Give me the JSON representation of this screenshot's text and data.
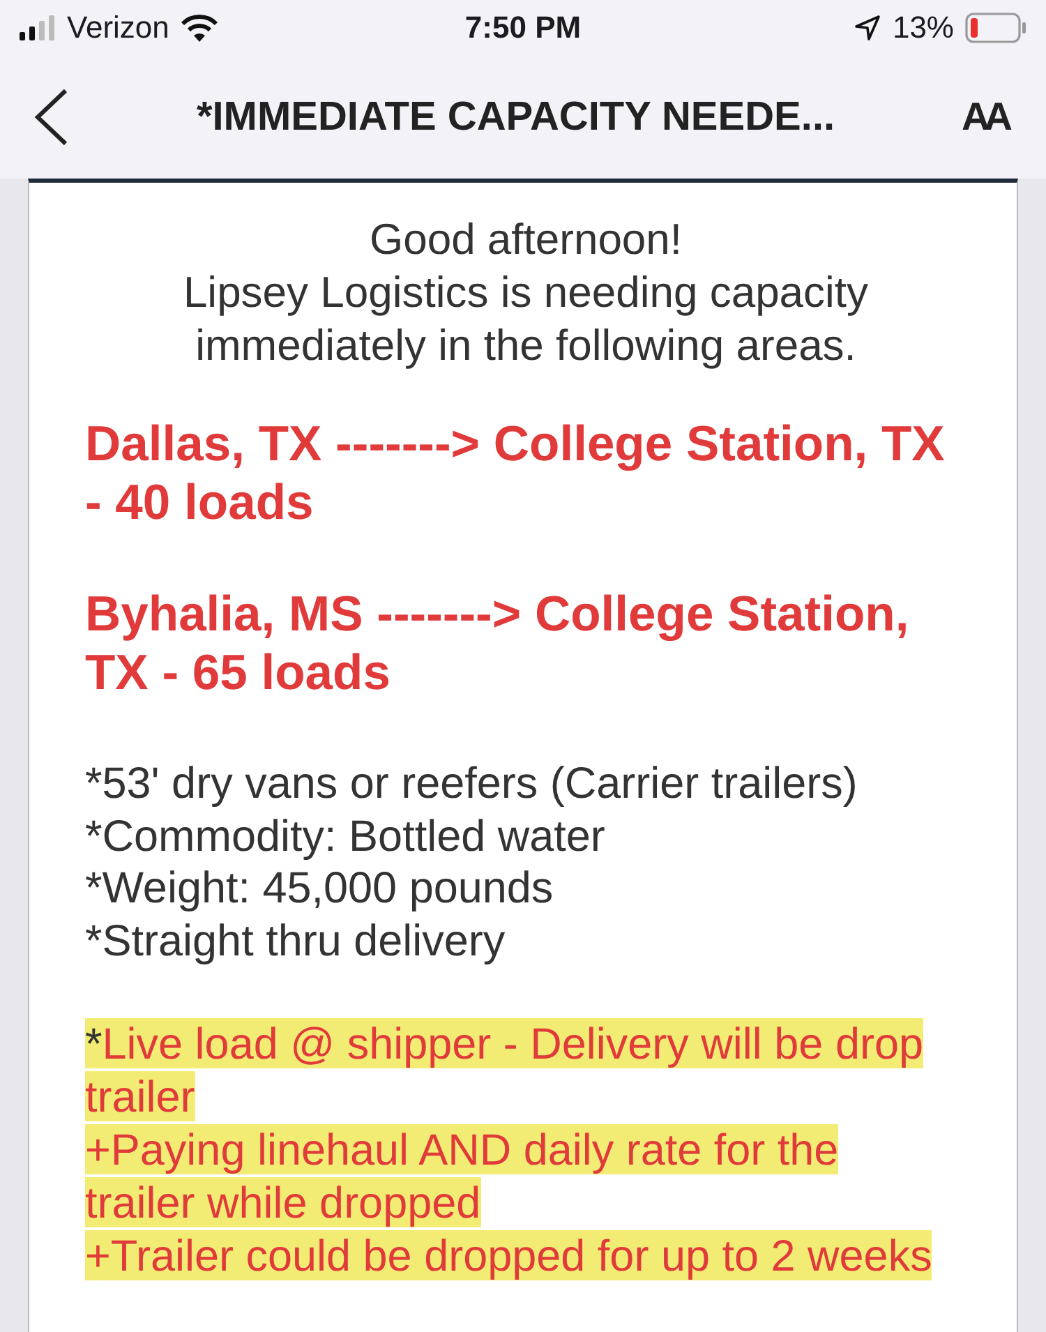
{
  "status_bar": {
    "carrier": "Verizon",
    "time": "7:50 PM",
    "battery": "13%"
  },
  "nav": {
    "title": "*IMMEDIATE CAPACITY NEEDE...",
    "text_size": "AA"
  },
  "greeting": [
    "Good afternoon!",
    "Lipsey Logistics is needing capacity immediately in the following areas."
  ],
  "lanes": [
    "Dallas, TX -------> College Station, TX - 40 loads",
    "Byhalia, MS -------> College Station, TX - 65 loads"
  ],
  "details": [
    "*53' dry vans or reefers (Carrier trailers)",
    "*Commodity: Bottled water",
    "*Weight: 45,000 pounds",
    "*Straight thru delivery"
  ],
  "highlights": [
    {
      "prefix": "*",
      "text": "Live load @ shipper - Delivery will be drop"
    },
    {
      "text": "trailer"
    },
    {
      "text": "+Paying linehaul AND daily rate for the"
    },
    {
      "text": "trailer while dropped"
    },
    {
      "text": "+Trailer could be dropped for up to 2 weeks"
    }
  ]
}
